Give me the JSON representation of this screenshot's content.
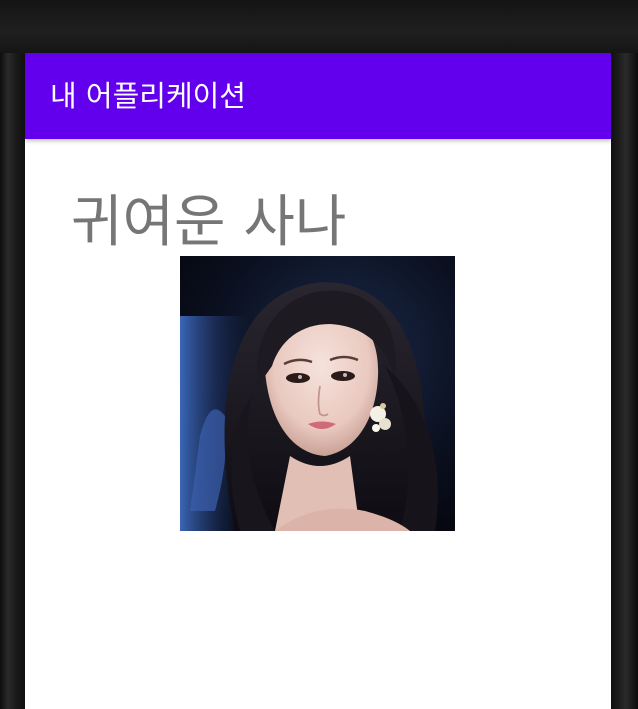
{
  "app_bar": {
    "title": "내 어플리케이션"
  },
  "main": {
    "heading_text": "귀여운 사나",
    "image": {
      "icon": "portrait-photo"
    }
  },
  "colors": {
    "app_bar": "#6200ee",
    "heading_text": "#767676",
    "background": "#ffffff"
  }
}
